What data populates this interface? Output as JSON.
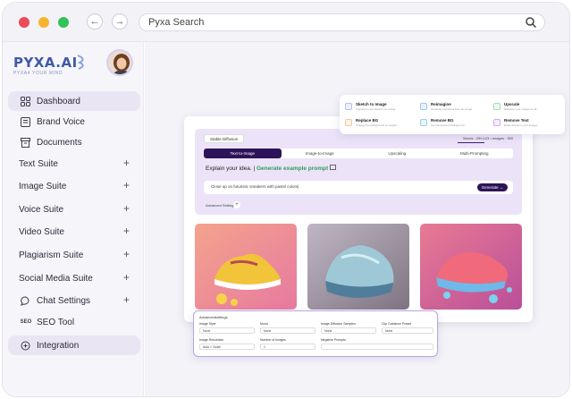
{
  "browser": {
    "search_placeholder": "Pyxa Search",
    "dot_colors": [
      "#ec4b5b",
      "#f5b52f",
      "#33c25a"
    ]
  },
  "sidebar": {
    "logo": "PYXA.AI",
    "tagline": "PYXA4 YOUR MIND",
    "items": [
      {
        "label": "Dashboard",
        "icon": "grid-icon",
        "active": true
      },
      {
        "label": "Brand Voice",
        "icon": "book-icon"
      },
      {
        "label": "Documents",
        "icon": "archive-icon"
      },
      {
        "label": "Text Suite",
        "expandable": true
      },
      {
        "label": "Image Suite",
        "expandable": true
      },
      {
        "label": "Voice Suite",
        "expandable": true
      },
      {
        "label": "Video Suite",
        "expandable": true
      },
      {
        "label": "Plagiarism Suite",
        "expandable": true
      },
      {
        "label": "Social Media Suite",
        "expandable": true
      },
      {
        "label": "Chat Settings",
        "icon": "chat-icon",
        "expandable": true
      },
      {
        "label": "SEO Tool",
        "icon": "seo-icon"
      },
      {
        "label": "Integration",
        "icon": "integration-icon",
        "active": true
      }
    ]
  },
  "tools": [
    {
      "title": "Sketch to Image",
      "sub": "Transform your sketch into image"
    },
    {
      "title": "Reimagine",
      "sub": "Generate variations from an image"
    },
    {
      "title": "Upscale",
      "sub": "Enhance your images to 4k"
    },
    {
      "title": "Replace BG",
      "sub": "Change the background of images"
    },
    {
      "title": "Remove BG",
      "sub": "Get transparent background"
    },
    {
      "title": "Remove Text",
      "sub": "Erase text from your images"
    }
  ],
  "generator": {
    "chip": "Stable Diffusion",
    "stats": "Words : 299,123  •  Images : 350",
    "tabs": [
      "Text-to-Image",
      "Image-to-Image",
      "Upscaling",
      "Multi-Prompting"
    ],
    "prompt_label": "Explain your idea. |",
    "example_link": "Generate example prompt",
    "prompt_value": "Close up on futuristic sneakers with pastel colors|",
    "generate_button": "Generate",
    "advanced": "Advanced Settings"
  },
  "settings": {
    "heading": "Advancedsettings",
    "fields": [
      {
        "label": "Image Style",
        "value": "None"
      },
      {
        "label": "Mood",
        "value": "None"
      },
      {
        "label": "Image Diffusion Samples",
        "value": "None"
      },
      {
        "label": "Clip Guidance Preset",
        "value": "None"
      },
      {
        "label": "Image Resolution",
        "value": "Auto × Scale"
      },
      {
        "label": "Number of Images",
        "value": "1"
      },
      {
        "label": "Negative Prompts",
        "value": ""
      }
    ]
  }
}
